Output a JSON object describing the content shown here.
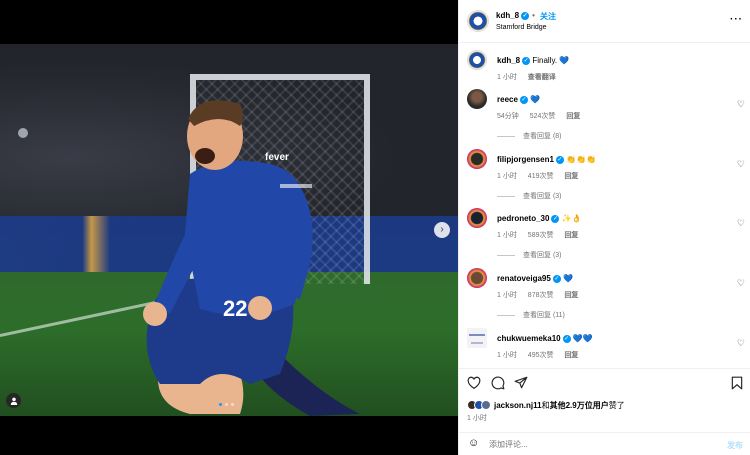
{
  "header": {
    "username": "kdh_8",
    "follow_label": "关注",
    "location": "Stamford Bridge",
    "more_label": "···"
  },
  "caption": {
    "username": "kdh_8",
    "text": "Finally.",
    "emoji": "💙",
    "time": "1 小时",
    "translate_label": "查看翻译"
  },
  "comments": [
    {
      "username": "reece",
      "text": "",
      "emoji": "💙",
      "time": "54分钟",
      "likes": "524次赞",
      "reply": "回复",
      "view_replies": "查看回复 (8)"
    },
    {
      "username": "filipjorgensen1",
      "text": "",
      "emoji": "👏👏👏",
      "time": "1 小时",
      "likes": "419次赞",
      "reply": "回复",
      "view_replies": "查看回复 (3)"
    },
    {
      "username": "pedroneto_30",
      "text": "",
      "emoji": "✨👌",
      "time": "1 小时",
      "likes": "589次赞",
      "reply": "回复",
      "view_replies": "查看回复 (3)"
    },
    {
      "username": "renatoveiga95",
      "text": "",
      "emoji": "💙",
      "time": "1 小时",
      "likes": "878次赞",
      "reply": "回复",
      "view_replies": "查看回复 (11)"
    },
    {
      "username": "chukwuemeka10",
      "text": "",
      "emoji": "💙💙",
      "time": "1 小时",
      "likes": "495次赞",
      "reply": "回复"
    }
  ],
  "likes": {
    "user": "jackson.nj11",
    "text_mid": "和",
    "others": "其他2.9万位用户",
    "text_end": "赞了",
    "time": "1 小时"
  },
  "compose": {
    "placeholder": "添加评论...",
    "post_label": "发布"
  },
  "media": {
    "shirt_sponsor": "fever",
    "shirt_number": "22",
    "carousel_count": 3,
    "carousel_active": 1
  },
  "colors": {
    "accent": "#0095f6",
    "chelsea_blue": "#1f4fa8"
  }
}
